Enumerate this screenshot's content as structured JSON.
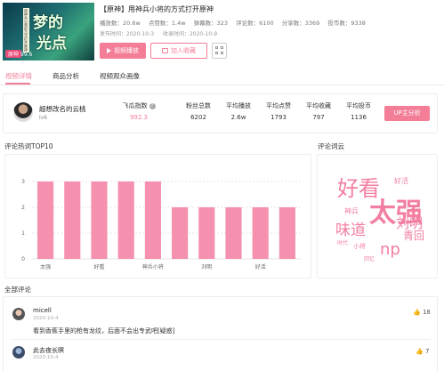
{
  "video": {
    "cover_title_1": "梦的",
    "cover_title_2": "光点",
    "cover_strip": "用神兵小将的方式打开原神",
    "cover_badge": "原神",
    "cover_score": "99.6",
    "title": "【原神】用神兵小将的方式打开原神",
    "stats": [
      "播放数：20.6w",
      "点赞数：1.4w",
      "弹幕数：323",
      "评论数：6100",
      "分享数：3369",
      "投币数：9338"
    ],
    "publish_time": "发布时间：2020-10-3",
    "record_time": "收录时间：2020-10-9",
    "play_button": "视频播放",
    "fav_button": "加入收藏"
  },
  "tabs": [
    "视频详情",
    "商品分析",
    "视频观众画像"
  ],
  "author": {
    "name": "超想改名的云桃",
    "level": "lv6",
    "up_button": "UP主分析"
  },
  "metrics": [
    {
      "label": "飞瓜指数",
      "value": "992.3"
    },
    {
      "label": "粉丝总数",
      "value": "6202"
    },
    {
      "label": "平均播放",
      "value": "2.6w"
    },
    {
      "label": "平均点赞",
      "value": "1793"
    },
    {
      "label": "平均收藏",
      "value": "797"
    },
    {
      "label": "平均投币",
      "value": "1136"
    }
  ],
  "sections": {
    "hot_words": "评论热词TOP10",
    "word_cloud": "评论词云",
    "all_comments": "全部评论"
  },
  "chart_data": {
    "type": "bar",
    "title": "",
    "categories": [
      "太强",
      "",
      "好看",
      "",
      "神兵小将",
      "",
      "刘明",
      "",
      "好活",
      ""
    ],
    "values": [
      3,
      3,
      3,
      3,
      3,
      2,
      2,
      2,
      2,
      2
    ],
    "ylim": [
      0,
      3
    ],
    "yticks": [
      "0",
      "1",
      "2",
      "3"
    ],
    "grid": true,
    "color": "#f590ae"
  },
  "word_cloud": [
    "好看",
    "太强",
    "刘明",
    "味道",
    "np",
    "青回",
    "神兵",
    "好活",
    "小将",
    "时代",
    "童年",
    "回忆"
  ],
  "comments": [
    {
      "user": "micell",
      "date": "2020-10-4",
      "text": "看到香蕉手里的枪有龙纹，后面不会出专武吧[疑惑]",
      "likes": "18"
    },
    {
      "user": "此去夜长暝",
      "date": "2020-10-4",
      "text": "",
      "likes": "7"
    }
  ],
  "colors": {
    "accent": "#f47d97",
    "bar": "#f590ae"
  }
}
